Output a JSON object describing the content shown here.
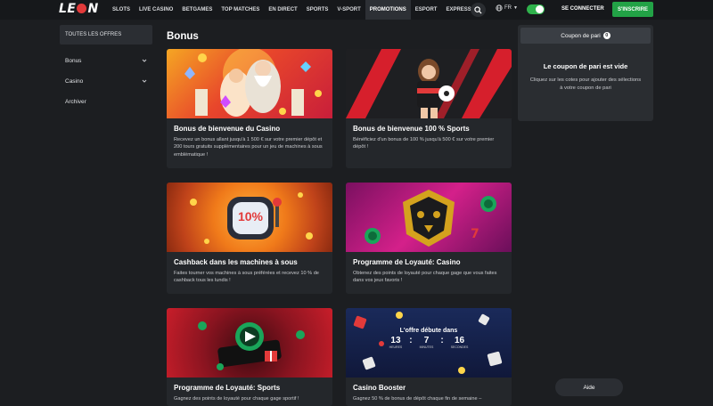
{
  "header": {
    "logo_text": "LEON",
    "nav": [
      "SLOTS",
      "LIVE CASINO",
      "BETGAMES",
      "TOP MATCHES",
      "EN DIRECT",
      "SPORTS",
      "V-SPORT",
      "PROMOTIONS",
      "ESPORT",
      "EXPRESS"
    ],
    "active_nav": "PROMOTIONS",
    "language": "FR",
    "login_label": "SE CONNECTER",
    "signup_label": "S'INSCRIRE"
  },
  "sidebar": {
    "items": [
      {
        "label": "TOUTES LES OFFRES",
        "chevron": false
      },
      {
        "label": "Bonus",
        "chevron": true
      },
      {
        "label": "Casino",
        "chevron": true
      },
      {
        "label": "Archiver",
        "chevron": false
      }
    ]
  },
  "main": {
    "title": "Bonus",
    "cards": [
      {
        "title": "Bonus de bienvenue du Casino",
        "desc": "Recevez un bonus allant jusqu'à 1 500 € sur votre premier dépôt et 200 tours gratuits supplémentaires pour un jeu de machines à sous emblématique !"
      },
      {
        "title": "Bonus de bienvenue 100 % Sports",
        "desc": "Bénéficiez d'un bonus de 100 % jusqu'à 500 € sur votre premier dépôt !"
      },
      {
        "title": "Cashback dans les machines à sous",
        "desc": "Faites tourner vos machines à sous préférées et recevez 10 % de cashback tous les lundis !"
      },
      {
        "title": "Programme de Loyauté: Casino",
        "desc": "Obtenez des points de loyauté pour chaque gage que vous faites dans vos jeux favoris !"
      },
      {
        "title": "Programme de Loyauté: Sports",
        "desc": "Gagnez des points de loyauté pour chaque gage sportif !"
      },
      {
        "title": "Casino Booster",
        "desc": "Gagnez 50 % de bonus de dépôt chaque fin de semaine –"
      }
    ],
    "cashback_badge": "10%",
    "countdown": {
      "label": "L'offre débute dans",
      "hours": "13",
      "minutes": "7",
      "seconds": "16",
      "hours_label": "HEURES",
      "minutes_label": "MINUTES",
      "seconds_label": "SECONDES"
    }
  },
  "coupon": {
    "tab_label": "Coupon de pari",
    "count": "0",
    "empty_title": "Le coupon de pari est vide",
    "empty_hint": "Cliquez sur les cotes pour ajouter des sélections à votre coupon de pari"
  },
  "help_label": "Aide",
  "colors": {
    "accent_green": "#22a246",
    "brand_red": "#e23a3a",
    "background": "#1c1e21"
  }
}
